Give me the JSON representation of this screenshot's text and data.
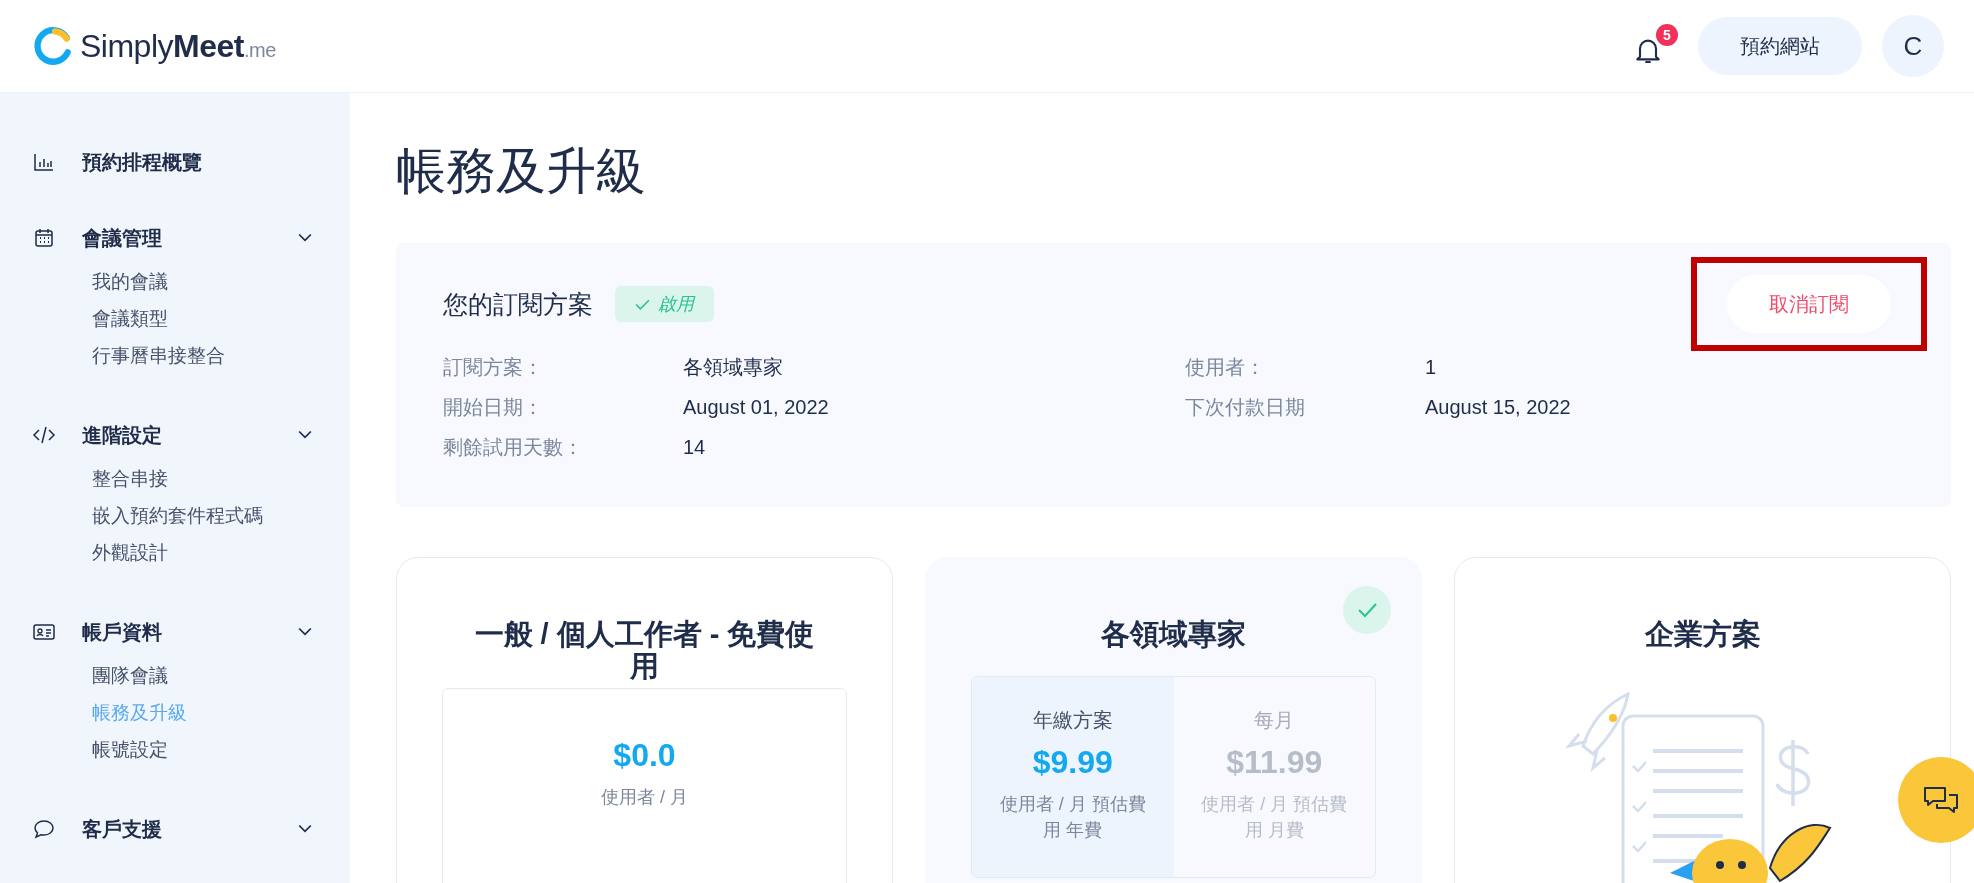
{
  "header": {
    "logo": {
      "light": "Simply",
      "bold": "Meet",
      "suffix": ".me"
    },
    "notifications": {
      "count": "5"
    },
    "booking_site_button": "預約網站",
    "avatar": "C"
  },
  "sidebar": {
    "sections": [
      {
        "label": "預約排程概覽"
      },
      {
        "label": "會議管理",
        "expanded": true,
        "children": [
          {
            "label": "我的會議",
            "selected": false
          },
          {
            "label": "會議類型",
            "selected": false
          },
          {
            "label": "行事曆串接整合",
            "selected": false
          }
        ]
      },
      {
        "label": "進階設定",
        "expanded": true,
        "children": [
          {
            "label": "整合串接",
            "selected": false
          },
          {
            "label": "嵌入預約套件程式碼",
            "selected": false
          },
          {
            "label": "外觀設計",
            "selected": false
          }
        ]
      },
      {
        "label": "帳戶資料",
        "expanded": true,
        "children": [
          {
            "label": "團隊會議",
            "selected": false
          },
          {
            "label": "帳務及升級",
            "selected": true
          },
          {
            "label": "帳號設定",
            "selected": false
          }
        ]
      },
      {
        "label": "客戶支援",
        "expanded": true
      }
    ]
  },
  "page_title": "帳務及升級",
  "subscription": {
    "title": "您的訂閱方案",
    "status": {
      "label": "啟用",
      "active": true
    },
    "cancel_button": {
      "label": "取消訂閱",
      "highlighted": true
    },
    "details_left": [
      {
        "label": "訂閱方案：",
        "value": "各領域專家"
      },
      {
        "label": "開始日期：",
        "value": "August 01, 2022"
      },
      {
        "label": "剩餘試用天數：",
        "value": "14"
      }
    ],
    "details_right": [
      {
        "label": "使用者：",
        "value": "1"
      },
      {
        "label": "下次付款日期",
        "value": "August 15, 2022"
      }
    ]
  },
  "plans": [
    {
      "kind": "free",
      "name": "一般 / 個人工作者 - 免費使用",
      "current": false,
      "options": [
        {
          "price": "$0.0",
          "note": "使用者 / 月"
        }
      ]
    },
    {
      "kind": "toggle",
      "name": "各領域專家",
      "current": true,
      "options": [
        {
          "label": "年繳方案",
          "price": "$9.99",
          "note": "使用者 / 月 預估費用 年費",
          "selected": true
        },
        {
          "label": "每月",
          "price": "$11.99",
          "note": "使用者 / 月 預估費用 月費",
          "selected": false
        }
      ]
    },
    {
      "kind": "enterprise",
      "name": "企業方案",
      "current": false
    }
  ]
}
